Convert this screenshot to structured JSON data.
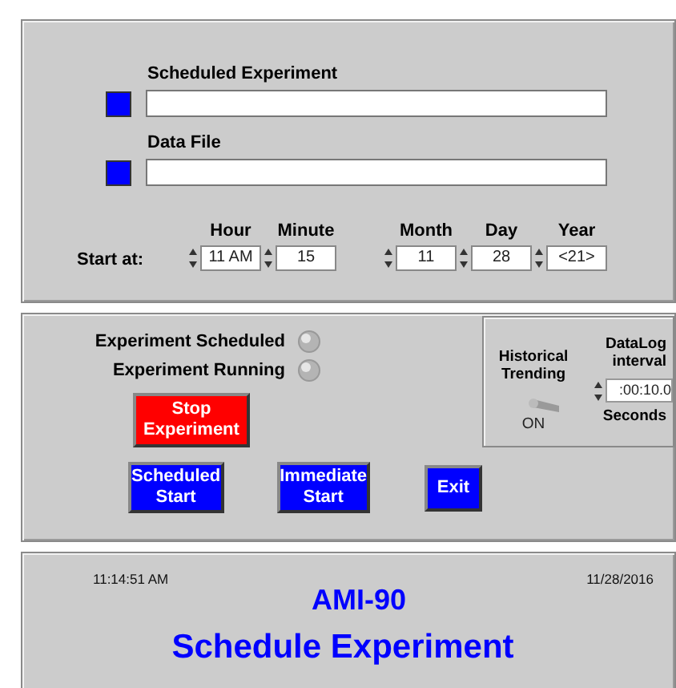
{
  "file_fields": [
    {
      "label": "Scheduled Experiment"
    },
    {
      "label": "Data File"
    }
  ],
  "start_at": {
    "label": "Start at:",
    "groups": [
      [
        {
          "label": "Hour",
          "value": "11 AM"
        },
        {
          "label": "Minute",
          "value": "15"
        }
      ],
      [
        {
          "label": "Month",
          "value": "11"
        },
        {
          "label": "Day",
          "value": "28"
        },
        {
          "label": "Year",
          "value": "<21>"
        }
      ]
    ]
  },
  "indicators": [
    {
      "label": "Experiment Scheduled",
      "lit": false
    },
    {
      "label": "Experiment Running",
      "lit": false
    }
  ],
  "stop_button": {
    "label": "Stop Experiment",
    "kind": "stop"
  },
  "buttons": [
    {
      "label": "Scheduled Start",
      "kind": "start"
    },
    {
      "label": "Immediate Start",
      "kind": "start"
    },
    {
      "label": "Exit",
      "kind": "start"
    }
  ],
  "historical_trending": {
    "label": "Historical Trending",
    "on": true,
    "state_label": "ON"
  },
  "datalog": {
    "label": "DataLog interval",
    "value": ":00:10.0",
    "unit": "Seconds"
  },
  "footer": {
    "time": "11:14:51 AM",
    "date": "11/28/2016",
    "title": "AMI-90",
    "subtitle": "Schedule Experiment"
  }
}
